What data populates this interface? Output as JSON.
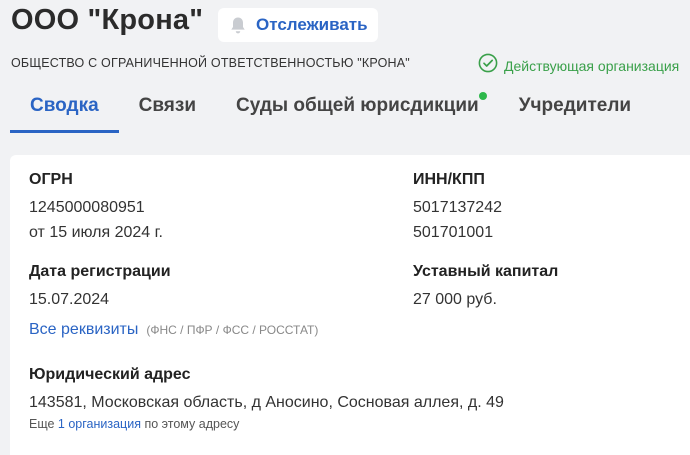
{
  "header": {
    "title": "ООО \"Крона\"",
    "follow_label": "Отслеживать",
    "full_name": "ОБЩЕСТВО С ОГРАНИЧЕННОЙ ОТВЕТСТВЕННОСТЬЮ \"КРОНА\"",
    "status_text": "Действующая организация"
  },
  "tabs": [
    {
      "label": "Сводка",
      "active": true
    },
    {
      "label": "Связи"
    },
    {
      "label": "Суды общей юрисдикции",
      "has_indicator": true
    },
    {
      "label": "Учредители"
    }
  ],
  "details": {
    "ogrn_label": "ОГРН",
    "ogrn_value": "1245000080951",
    "ogrn_date": "от 15 июля 2024 г.",
    "inn_label": "ИНН/КПП",
    "inn_value": "5017137242",
    "kpp_value": "501701001",
    "reg_date_label": "Дата регистрации",
    "reg_date_value": "15.07.2024",
    "capital_label": "Уставный капитал",
    "capital_value": "27 000 руб.",
    "all_details_link": "Все реквизиты",
    "all_details_note": "(ФНС / ПФР / ФСС / РОССТАТ)",
    "address_label": "Юридический адрес",
    "address_value": "143581, Московская область, д Аносино, Сосновая аллея, д. 49",
    "address_more_prefix": "Еще",
    "address_more_link": "1 организация",
    "address_more_suffix": "по этому адресу"
  },
  "colors": {
    "accent": "#2a64c4",
    "status_green": "#3aa04a",
    "indicator_green": "#2db84b"
  },
  "icons": {
    "follow": "bell-icon",
    "status": "check-circle-icon"
  }
}
